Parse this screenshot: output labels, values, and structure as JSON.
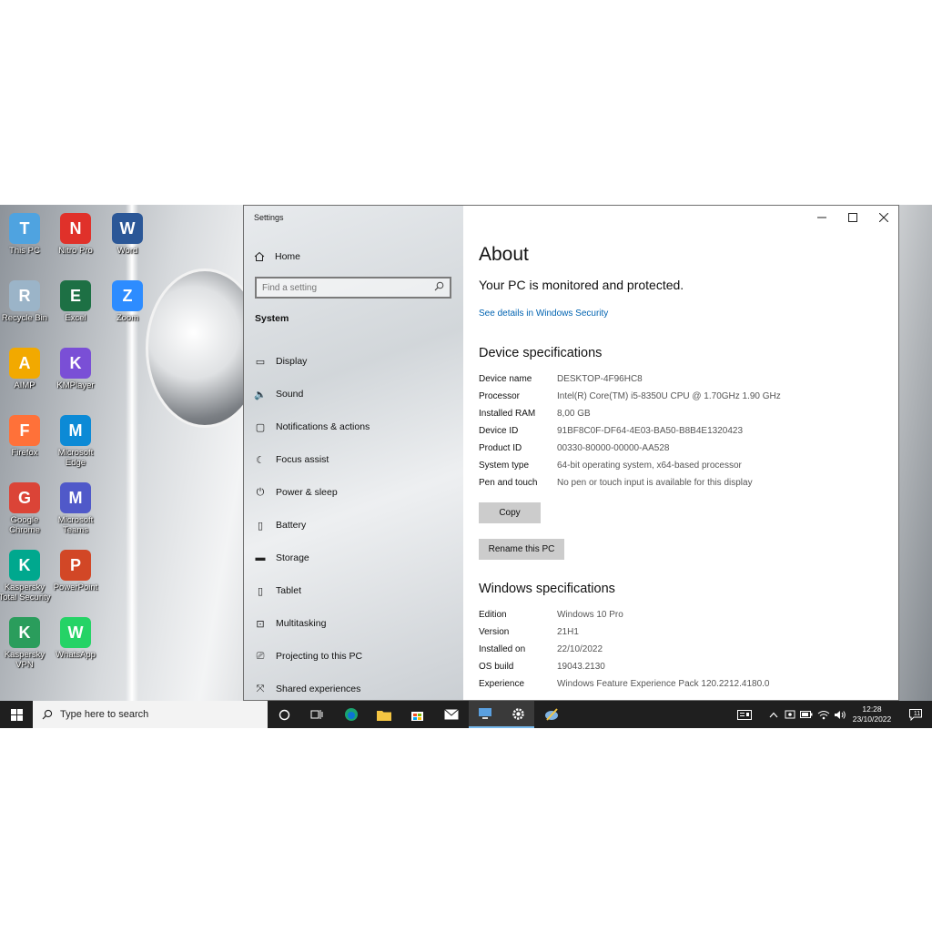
{
  "desktop": {
    "icons": [
      {
        "label": "This PC",
        "icon": "monitor-icon",
        "color": "#4fa3e0"
      },
      {
        "label": "Nitro Pro",
        "icon": "nitro-pro-icon",
        "color": "#e0312a"
      },
      {
        "label": "Word",
        "icon": "word-icon",
        "color": "#2b5797"
      },
      {
        "label": "Recycle Bin",
        "icon": "recycle-bin-icon",
        "color": "#9bb4c8"
      },
      {
        "label": "Excel",
        "icon": "excel-icon",
        "color": "#1d7044"
      },
      {
        "label": "Zoom",
        "icon": "zoom-icon",
        "color": "#2d8cff"
      },
      {
        "label": "AIMP",
        "icon": "aimp-icon",
        "color": "#f2a900"
      },
      {
        "label": "KMPlayer",
        "icon": "kmplayer-icon",
        "color": "#7a4fd6"
      },
      {
        "label": "Firefox",
        "icon": "firefox-icon",
        "color": "#ff7139"
      },
      {
        "label": "Microsoft Edge",
        "icon": "edge-icon",
        "color": "#0c8ad6"
      },
      {
        "label": "Google Chrome",
        "icon": "chrome-icon",
        "color": "#db4437"
      },
      {
        "label": "Microsoft Teams",
        "icon": "teams-icon",
        "color": "#5059c9"
      },
      {
        "label": "Kaspersky Total Security",
        "icon": "kaspersky-icon",
        "color": "#00a88e"
      },
      {
        "label": "PowerPoint",
        "icon": "powerpoint-icon",
        "color": "#d24726"
      },
      {
        "label": "Kaspersky VPN",
        "icon": "kaspersky-vpn-icon",
        "color": "#2a9d5c"
      },
      {
        "label": "WhatsApp",
        "icon": "whatsapp-icon",
        "color": "#25d366"
      }
    ]
  },
  "window": {
    "title": "Settings",
    "home_label": "Home",
    "search_placeholder": "Find a setting",
    "section_label": "System",
    "nav_items": [
      {
        "label": "Display",
        "icon": "display-icon"
      },
      {
        "label": "Sound",
        "icon": "sound-icon"
      },
      {
        "label": "Notifications & actions",
        "icon": "notifications-icon"
      },
      {
        "label": "Focus assist",
        "icon": "focus-assist-icon"
      },
      {
        "label": "Power & sleep",
        "icon": "power-icon"
      },
      {
        "label": "Battery",
        "icon": "battery-icon"
      },
      {
        "label": "Storage",
        "icon": "storage-icon"
      },
      {
        "label": "Tablet",
        "icon": "tablet-icon"
      },
      {
        "label": "Multitasking",
        "icon": "multitasking-icon"
      },
      {
        "label": "Projecting to this PC",
        "icon": "projecting-icon"
      },
      {
        "label": "Shared experiences",
        "icon": "shared-experiences-icon"
      }
    ]
  },
  "about": {
    "title": "About",
    "protected_text": "Your PC is monitored and protected.",
    "security_link": "See details in Windows Security",
    "device_heading": "Device specifications",
    "device_specs": [
      {
        "key": "Device name",
        "value": "DESKTOP-4F96HC8"
      },
      {
        "key": "Processor",
        "value": "Intel(R) Core(TM) i5-8350U CPU @ 1.70GHz   1.90 GHz"
      },
      {
        "key": "Installed RAM",
        "value": "8,00 GB"
      },
      {
        "key": "Device ID",
        "value": "91BF8C0F-DF64-4E03-BA50-B8B4E1320423"
      },
      {
        "key": "Product ID",
        "value": "00330-80000-00000-AA528"
      },
      {
        "key": "System type",
        "value": "64-bit operating system, x64-based processor"
      },
      {
        "key": "Pen and touch",
        "value": "No pen or touch input is available for this display"
      }
    ],
    "copy_label": "Copy",
    "rename_label": "Rename this PC",
    "windows_heading": "Windows specifications",
    "windows_specs": [
      {
        "key": "Edition",
        "value": "Windows 10 Pro"
      },
      {
        "key": "Version",
        "value": "21H1"
      },
      {
        "key": "Installed on",
        "value": "22/10/2022"
      },
      {
        "key": "OS build",
        "value": "19043.2130"
      },
      {
        "key": "Experience",
        "value": "Windows Feature Experience Pack 120.2212.4180.0"
      }
    ]
  },
  "taskbar": {
    "search_placeholder": "Type here to search",
    "time": "12:28",
    "date": "23/10/2022",
    "notification_count": "11"
  }
}
